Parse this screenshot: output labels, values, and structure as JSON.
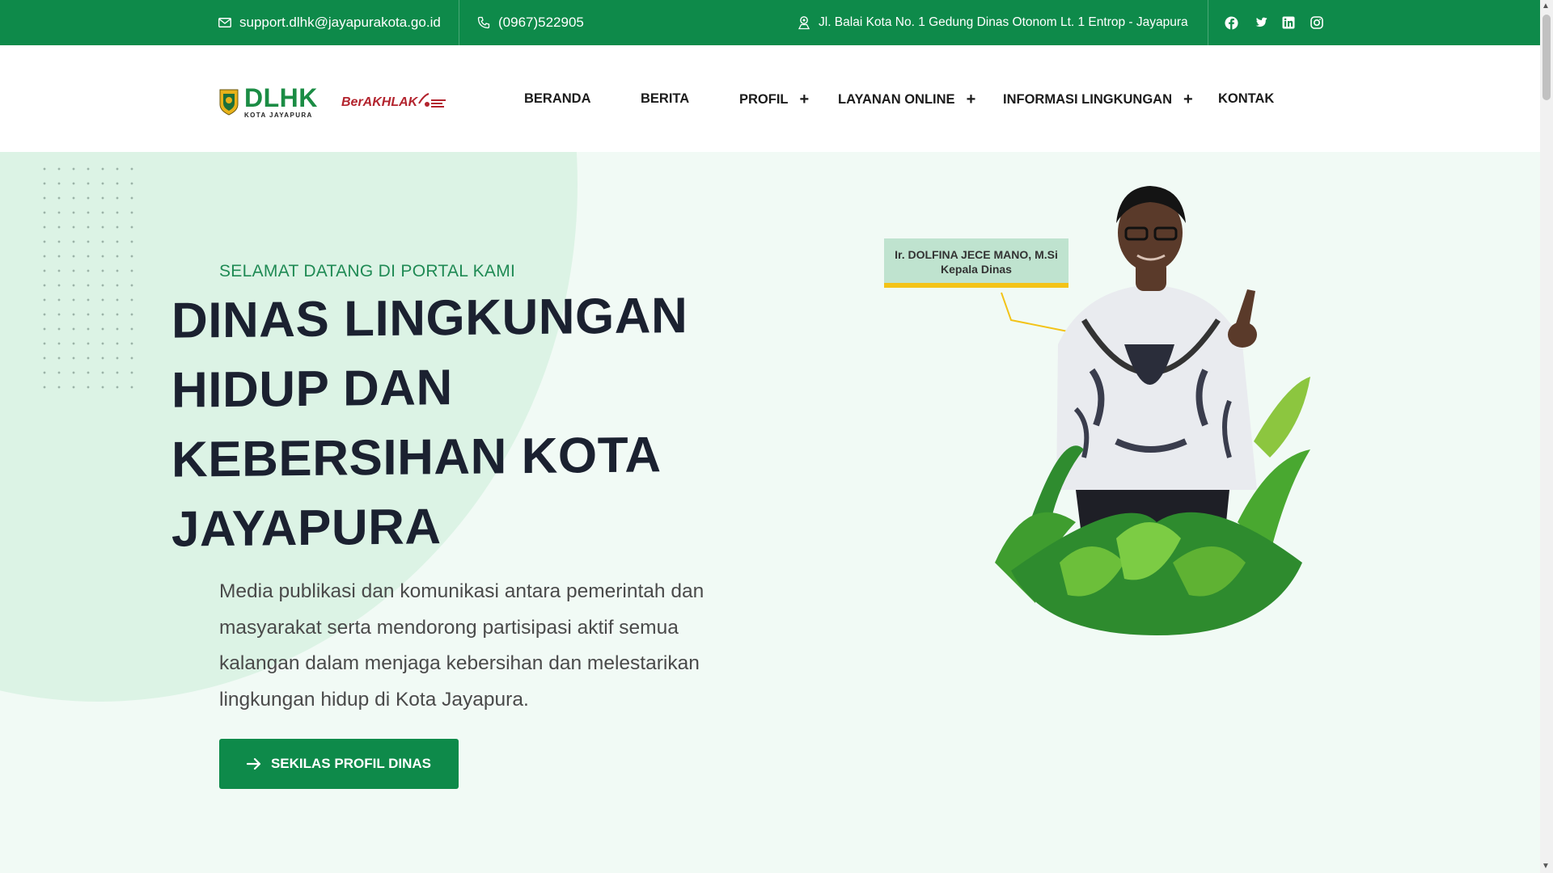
{
  "topbar": {
    "email": "support.dlhk@jayapurakota.go.id",
    "phone": "(0967)522905",
    "address": "Jl. Balai Kota No. 1 Gedung Dinas Otonom Lt. 1 Entrop - Jayapura",
    "social_icons": [
      "facebook-icon",
      "twitter-icon",
      "linkedin-icon",
      "instagram-icon"
    ]
  },
  "logo": {
    "main": "DLHK",
    "sub": "KOTA JAYAPURA",
    "secondary": "BerAKHLAK"
  },
  "nav": {
    "items": [
      {
        "label": "BERANDA",
        "has_submenu": false
      },
      {
        "label": "BERITA",
        "has_submenu": false
      },
      {
        "label": "PROFIL",
        "has_submenu": true
      },
      {
        "label": "LAYANAN ONLINE",
        "has_submenu": true
      },
      {
        "label": "INFORMASI LINGKUNGAN",
        "has_submenu": true
      },
      {
        "label": "KONTAK",
        "has_submenu": false
      }
    ],
    "submenu_symbol": "+"
  },
  "hero": {
    "kicker": "SELAMAT DATANG DI PORTAL KAMI",
    "headline_lines": [
      "DINAS LINGKUNGAN",
      "HIDUP DAN",
      "KEBERSIHAN KOTA",
      "JAYAPURA"
    ],
    "description": "Media publikasi dan komunikasi antara pemerintah dan masyarakat serta mendorong partisipasi aktif semua kalangan dalam menjaga kebersihan dan melestarikan lingkungan hidup di Kota Jayapura.",
    "cta_label": "SEKILAS PROFIL DINAS"
  },
  "official": {
    "name": "Ir. DOLFINA JECE MANO, M.Si",
    "title": "Kepala Dinas"
  },
  "colors": {
    "primary": "#0e8a4a",
    "accent": "#f3c318",
    "hero_bg": "#f1faf5"
  }
}
